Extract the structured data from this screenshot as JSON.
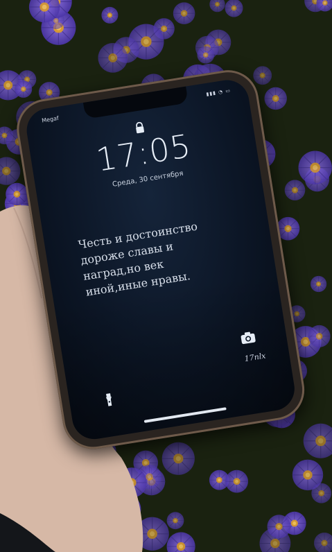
{
  "lockscreen": {
    "carrier": "Megaf",
    "status_icons": "▮▮▮ ◔ ▭",
    "time": "17:05",
    "date": "Среда, 30 сентября",
    "quote_lines": [
      "Честь и достоинство",
      "дороже славы и",
      "наград,но век",
      "иной,иные нравы."
    ],
    "signature": "17nlx"
  },
  "icons": {
    "lock": "lock-icon",
    "flashlight": "flashlight-icon",
    "camera": "camera-icon"
  },
  "colors": {
    "screen": "#0c1626",
    "flower_petal": "#6b4fc9",
    "flower_center": "#e0a63a",
    "foliage": "#1c2410"
  }
}
